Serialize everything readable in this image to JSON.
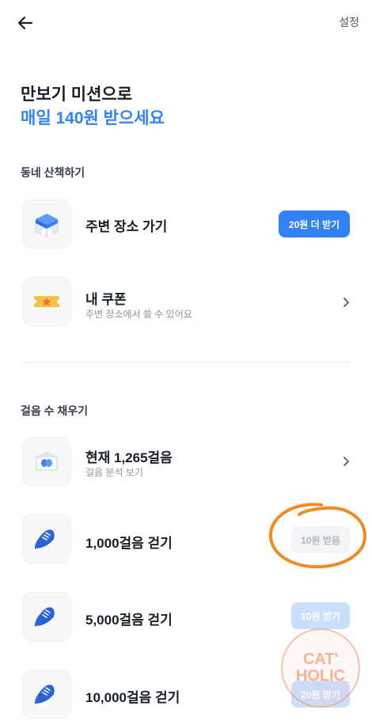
{
  "header": {
    "settings_label": "설정"
  },
  "hero": {
    "line1": "만보기 미션으로",
    "line2": "매일 140원 받으세요"
  },
  "section1": {
    "title": "동네 산책하기",
    "items": [
      {
        "title": "주변 장소 가기",
        "button_label": "20원 더 받기",
        "icon": "place-icon"
      },
      {
        "title": "내 쿠폰",
        "subtitle": "주변 장소에서 쓸 수 있어요",
        "icon": "coupon-icon"
      }
    ]
  },
  "section2": {
    "title": "걸음 수 채우기",
    "items": [
      {
        "title": "현재 1,265걸음",
        "subtitle": "걸음 분석 보기",
        "icon": "steps-analysis-icon"
      },
      {
        "title": "1,000걸음 걷기",
        "button_label": "10원 받음",
        "icon": "sneaker-icon"
      },
      {
        "title": "5,000걸음 걷기",
        "button_label": "10원 받기",
        "icon": "sneaker-icon"
      },
      {
        "title": "10,000걸음 걷기",
        "button_label": "20원 받기",
        "icon": "sneaker-icon"
      }
    ]
  },
  "watermark": {
    "line1": "CAT'",
    "line2": "HOLIC"
  },
  "colors": {
    "accent": "#3182f6",
    "annotation": "#f08a24"
  }
}
